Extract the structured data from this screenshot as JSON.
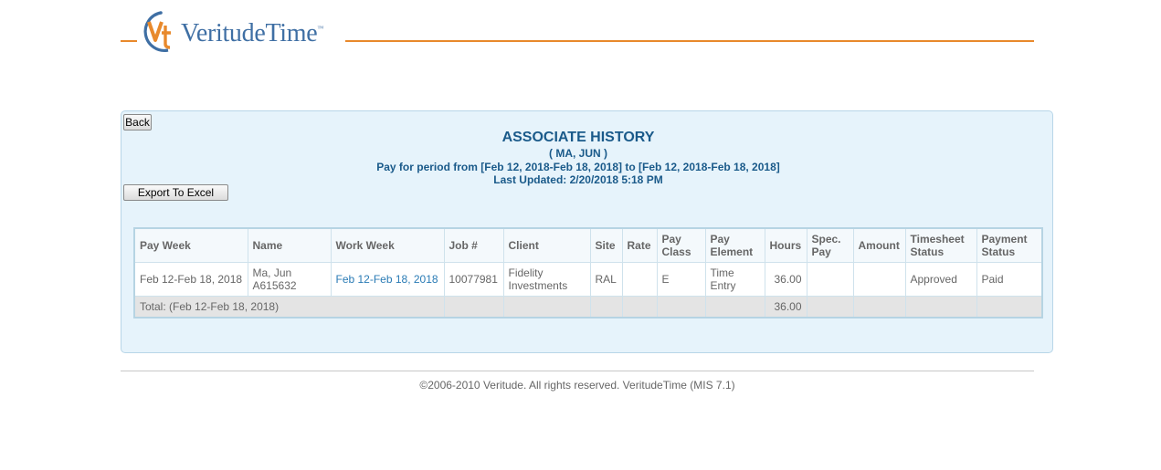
{
  "header": {
    "logo_text": "VeritudeTime",
    "logo_tm": "™"
  },
  "panel": {
    "back_label": "Back",
    "title": "ASSOCIATE HISTORY",
    "associate": "( MA, JUN )",
    "pay_period": "Pay for period from [Feb 12, 2018-Feb 18, 2018] to [Feb 12, 2018-Feb 18, 2018]",
    "last_updated": "Last Updated: 2/20/2018 5:18 PM",
    "export_label": "Export To Excel"
  },
  "table": {
    "headers": {
      "pay_week": "Pay Week",
      "name": "Name",
      "work_week": "Work Week",
      "job": "Job #",
      "client": "Client",
      "site": "Site",
      "rate": "Rate",
      "pay_class_1": "Pay",
      "pay_class_2": "Class",
      "pay_element_1": "Pay",
      "pay_element_2": "Element",
      "hours": "Hours",
      "spec_pay_1": "Spec.",
      "spec_pay_2": "Pay",
      "amount": "Amount",
      "timesheet_status_1": "Timesheet",
      "timesheet_status_2": "Status",
      "payment_status_1": "Payment",
      "payment_status_2": "Status"
    },
    "rows": [
      {
        "pay_week": "Feb 12-Feb 18, 2018",
        "name_1": "Ma, Jun",
        "name_2": "A615632",
        "work_week": "Feb 12-Feb 18, 2018",
        "job": "10077981",
        "client_1": "Fidelity",
        "client_2": "Investments",
        "site": "RAL",
        "rate": "",
        "pay_class": "E",
        "pay_element_1": "Time",
        "pay_element_2": "Entry",
        "hours": "36.00",
        "spec_pay": "",
        "amount": "",
        "timesheet_status": "Approved",
        "payment_status": "Paid"
      }
    ],
    "total": {
      "label": "Total: (Feb 12-Feb 18, 2018)",
      "hours": "36.00"
    }
  },
  "footer": {
    "copyright": "©2006-2010 Veritude. All rights reserved. VeritudeTime (MIS 7.1)"
  },
  "colors": {
    "accent_orange": "#e8892c",
    "brand_blue": "#3f6fa4",
    "title_blue": "#1a5a8a",
    "panel_bg": "#e6f3fb"
  }
}
